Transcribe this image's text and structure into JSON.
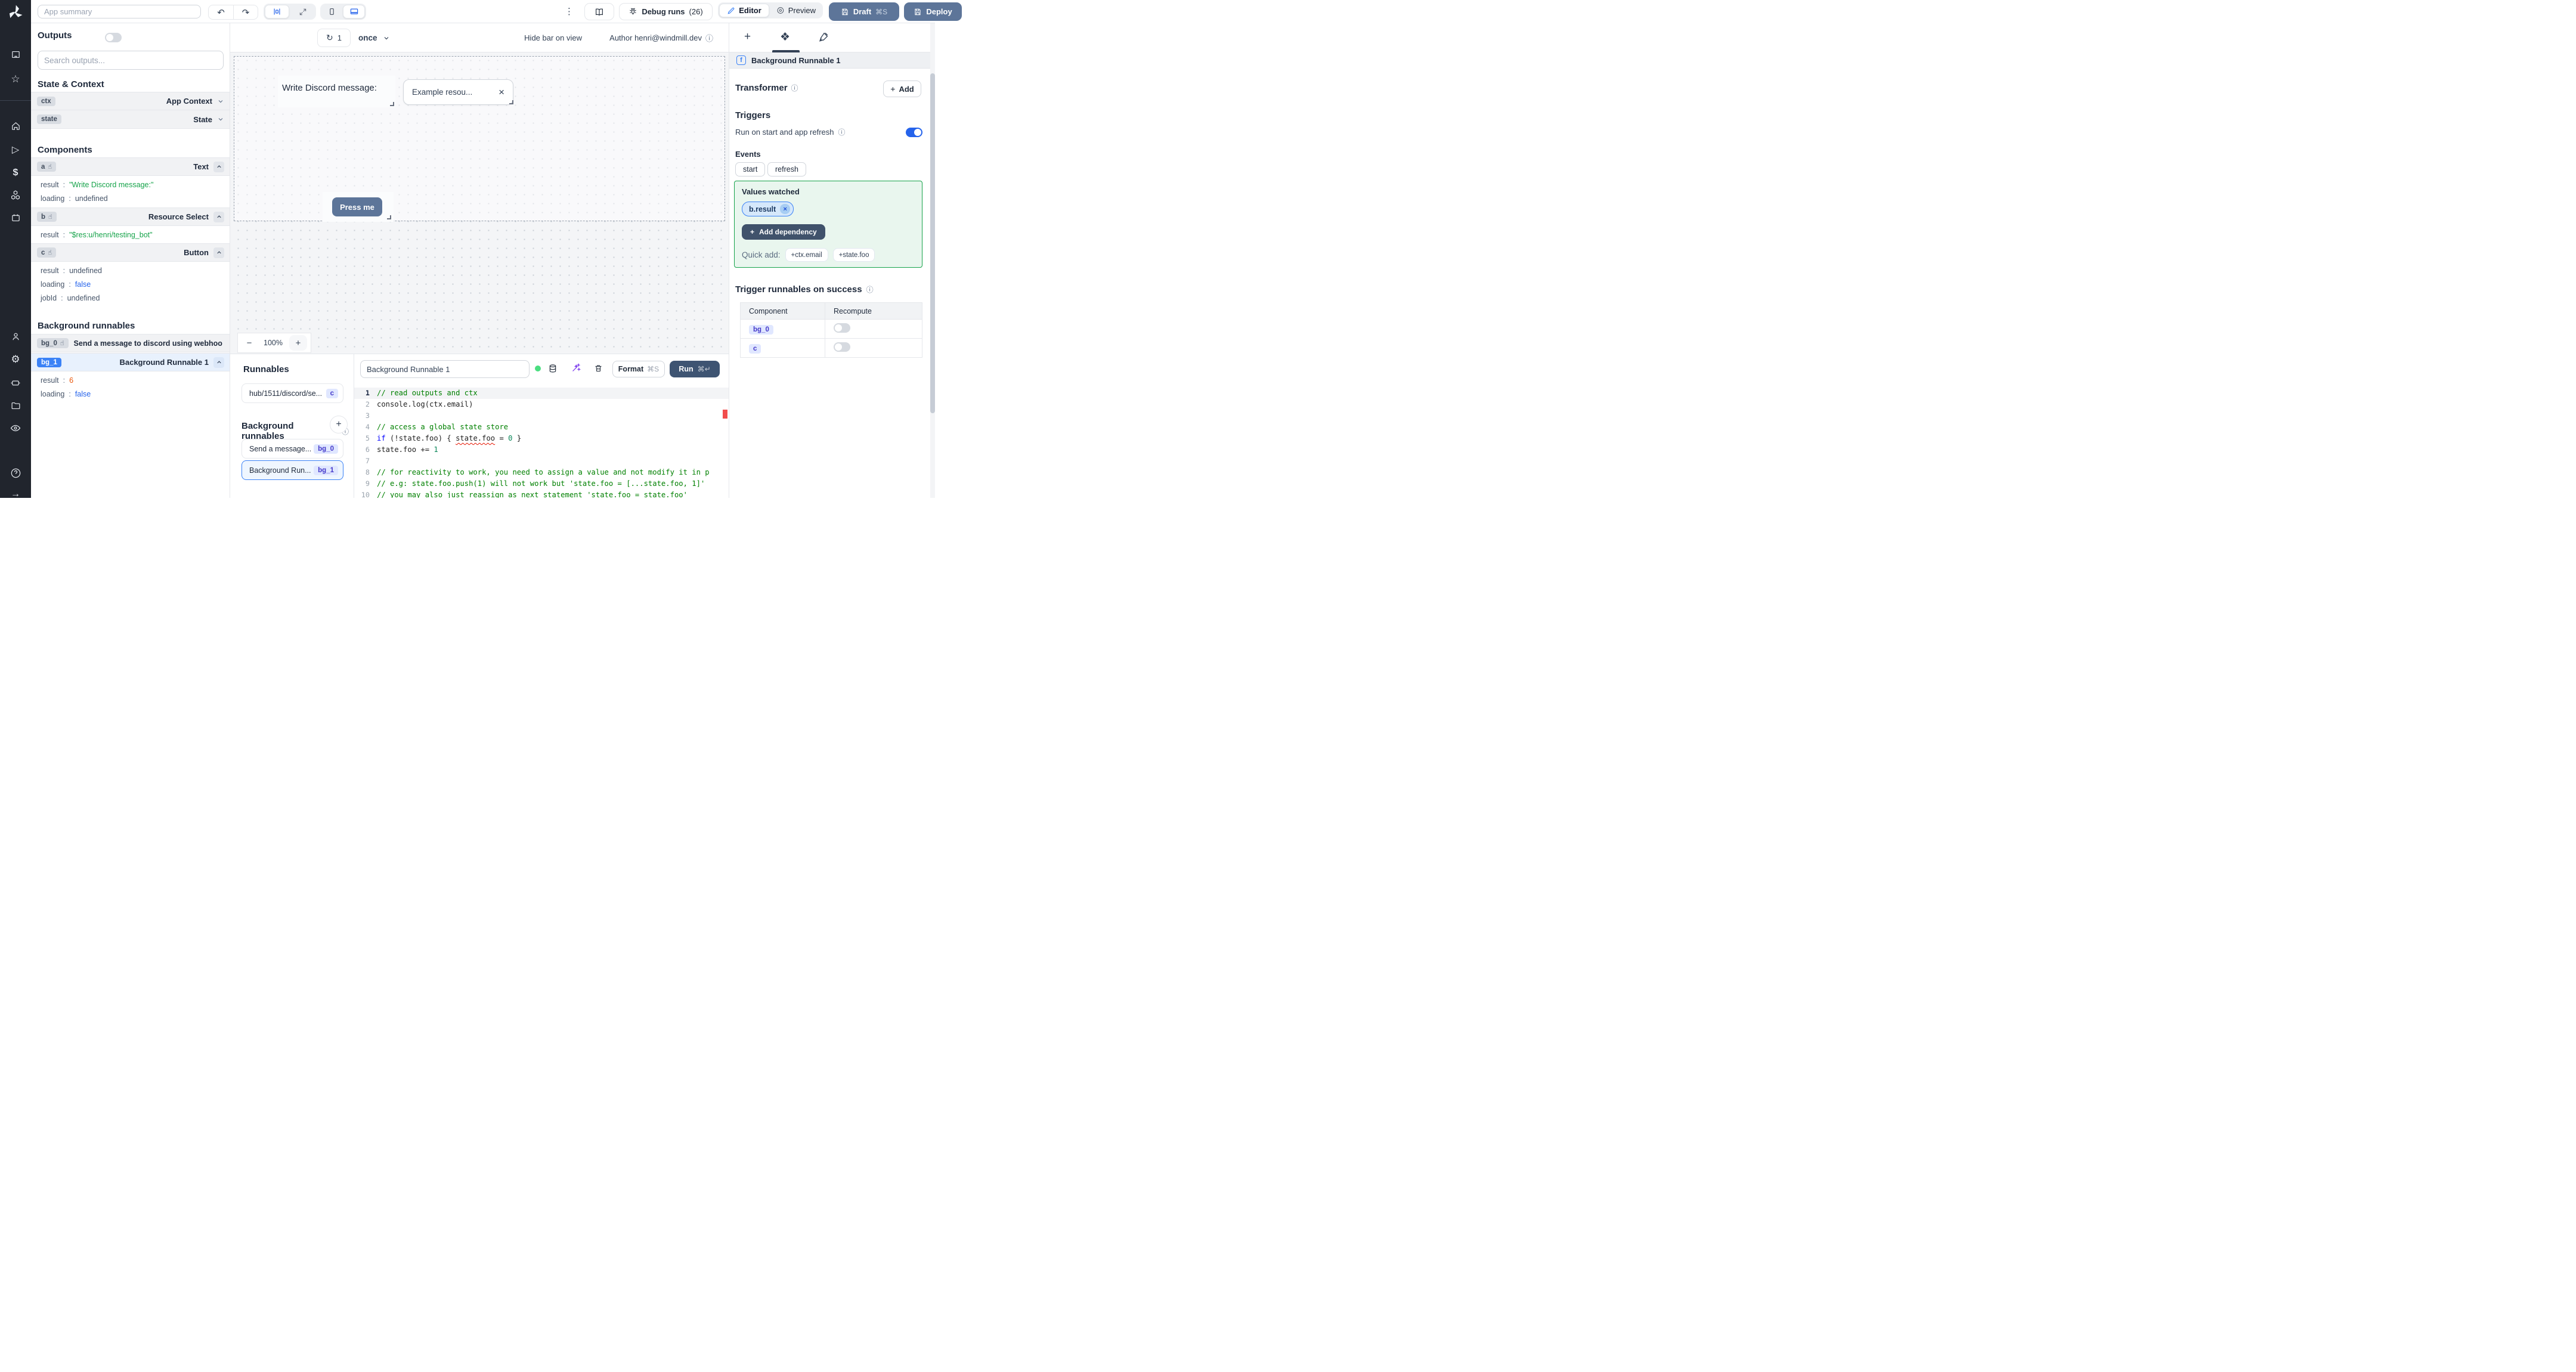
{
  "icons": {
    "undo": "↶",
    "redo": "↷",
    "kebab": "⋮",
    "refresh": "↻",
    "info": "ⓘ",
    "star": "☆",
    "play": "▷",
    "dollar": "$",
    "gear": "⚙",
    "help": "?",
    "arrow_right": "→",
    "pointer": "☝",
    "close": "×",
    "plus": "+",
    "minus": "−",
    "diamond": "❖"
  },
  "colors": {
    "accent_blue": "#3b82f6",
    "slate_button": "#5d7599",
    "rail_bg": "#21252d",
    "green_border": "#16a34a",
    "string_green": "#16a34a",
    "bool_blue": "#2563eb",
    "num_orange": "#ea580c",
    "error_red": "#f14c4c"
  },
  "topbar": {
    "app_summary_placeholder": "App summary",
    "debug_runs_label": "Debug runs",
    "debug_runs_count": "(26)",
    "editor_label": "Editor",
    "preview_label": "Preview",
    "draft_label": "Draft",
    "draft_shortcut": "⌘S",
    "deploy_label": "Deploy"
  },
  "left": {
    "title": "Outputs",
    "search_placeholder": "Search outputs...",
    "state_context_title": "State & Context",
    "ctx_id": "ctx",
    "ctx_type": "App Context",
    "state_id": "state",
    "state_type": "State",
    "components_title": "Components",
    "a_id": "a",
    "a_type": "Text",
    "a_result_k": "result",
    "a_result_v": "\"Write Discord message:\"",
    "a_loading_k": "loading",
    "a_loading_v": "undefined",
    "b_id": "b",
    "b_type": "Resource Select",
    "b_result_k": "result",
    "b_result_v": "\"$res:u/henri/testing_bot\"",
    "c_id": "c",
    "c_type": "Button",
    "c_result_k": "result",
    "c_result_v": "undefined",
    "c_loading_k": "loading",
    "c_loading_v": "false",
    "c_jobid_k": "jobId",
    "c_jobid_v": "undefined",
    "bg_title": "Background runnables",
    "bg0_id": "bg_0",
    "bg0_name": "Send a message to discord using webhoo",
    "bg1_id": "bg_1",
    "bg1_name": "Background Runnable 1",
    "bg1_result_k": "result",
    "bg1_result_v": "6",
    "bg1_loading_k": "loading",
    "bg1_loading_v": "false"
  },
  "canvas": {
    "refresh_count": "1",
    "mode": "once",
    "hide_bar_label": "Hide bar on view",
    "author_label": "Author henri@windmill.dev",
    "zoom_level": "100%",
    "text_component": "Write Discord message:",
    "select_value": "Example resou...",
    "button_label": "Press me"
  },
  "runnables": {
    "title": "Runnables",
    "hub_item": "hub/1511/discord/se...",
    "hub_badge": "c",
    "bg_title": "Background runnables",
    "bg0_name": "Send a message...",
    "bg0_badge": "bg_0",
    "bg1_name": "Background Run...",
    "bg1_badge": "bg_1"
  },
  "editor": {
    "name_value": "Background Runnable 1",
    "format_label": "Format",
    "format_shortcut": "⌘S",
    "run_label": "Run",
    "run_shortcut": "⌘↵",
    "code": {
      "lines": [
        {
          "n": "1",
          "a": true,
          "t": [
            [
              "cm",
              "// read outputs and ctx"
            ]
          ]
        },
        {
          "n": "2",
          "t": [
            [
              "df",
              "console.log(ctx.email)"
            ]
          ]
        },
        {
          "n": "3",
          "t": []
        },
        {
          "n": "4",
          "t": [
            [
              "cm",
              "// access a global state store"
            ]
          ]
        },
        {
          "n": "5",
          "t": [
            [
              "kw",
              "if"
            ],
            [
              "df",
              " (!state.foo) { "
            ],
            [
              "er",
              "state.foo"
            ],
            [
              "df",
              " = "
            ],
            [
              "nm",
              "0"
            ],
            [
              "df",
              " }"
            ]
          ]
        },
        {
          "n": "6",
          "t": [
            [
              "df",
              "state.foo += "
            ],
            [
              "nm",
              "1"
            ]
          ]
        },
        {
          "n": "7",
          "t": []
        },
        {
          "n": "8",
          "t": [
            [
              "cm",
              "// for reactivity to work, you need to assign a value and not modify it in p"
            ]
          ]
        },
        {
          "n": "9",
          "t": [
            [
              "cm",
              "// e.g: state.foo.push(1) will not work but 'state.foo = [...state.foo, 1]'"
            ]
          ]
        },
        {
          "n": "10",
          "t": [
            [
              "cm",
              "// you may also just reassign as next statement 'state.foo = state.foo'"
            ]
          ]
        }
      ]
    }
  },
  "right": {
    "header_title": "Background Runnable 1",
    "f_glyph": "f",
    "transformer_label": "Transformer",
    "add_label": "Add",
    "triggers_label": "Triggers",
    "run_on_start_label": "Run on start and app refresh",
    "events_label": "Events",
    "chip_start": "start",
    "chip_refresh": "refresh",
    "values_watched_label": "Values watched",
    "dependency_chip": "b.result",
    "add_dependency_label": "Add dependency",
    "quick_add_label": "Quick add:",
    "quick_add_1": "+ctx.email",
    "quick_add_2": "+state.foo",
    "trigger_success_label": "Trigger runnables on success",
    "col_component": "Component",
    "col_recompute": "Recompute",
    "row1_badge": "bg_0",
    "row2_badge": "c"
  }
}
